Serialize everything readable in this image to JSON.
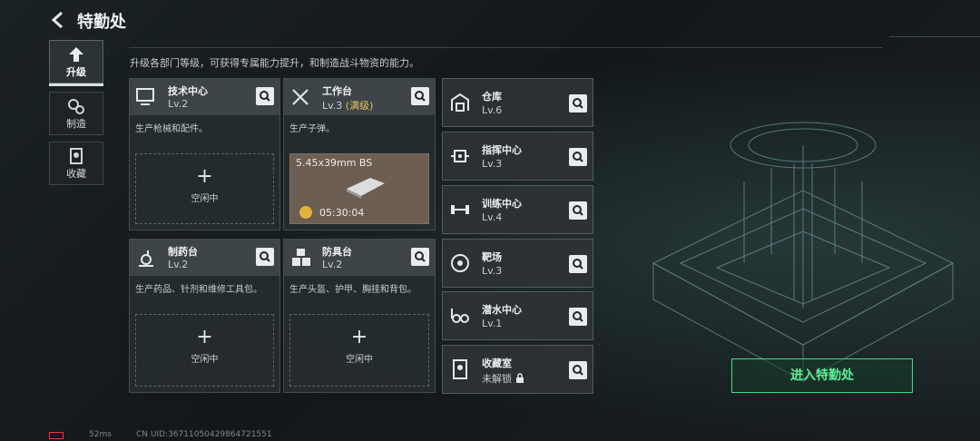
{
  "header": {
    "title": "特勤处",
    "back_icon": "back-arrow-icon"
  },
  "description": "升级各部门等级，可获得专属能力提升，和制造战斗物资的能力。",
  "nav": [
    {
      "label": "升级",
      "icon": "upgrade-icon",
      "active": true
    },
    {
      "label": "制造",
      "icon": "gears-icon",
      "active": false
    },
    {
      "label": "收藏",
      "icon": "collection-icon",
      "active": false
    }
  ],
  "cards": {
    "tech": {
      "name": "技术中心",
      "level": "Lv.2",
      "desc": "生产枪械和配件。",
      "slot": {
        "plus": "+",
        "label": "空闲中"
      }
    },
    "workbench": {
      "name": "工作台",
      "level": "Lv.3",
      "level_note": "(满级)",
      "desc": "生产子弹。",
      "production": {
        "item": "5.45x39mm BS",
        "time": "05:30:04"
      }
    },
    "pharmacy": {
      "name": "制药台",
      "level": "Lv.2",
      "desc": "生产药品、针剂和维修工具包。",
      "slot": {
        "plus": "+",
        "label": "空闲中"
      }
    },
    "armor": {
      "name": "防具台",
      "level": "Lv.2",
      "desc": "生产头盔、护甲、胸挂和背包。",
      "slot": {
        "plus": "+",
        "label": "空闲中"
      }
    }
  },
  "right_list": [
    {
      "name": "仓库",
      "level": "Lv.6",
      "icon": "warehouse-icon"
    },
    {
      "name": "指挥中心",
      "level": "Lv.3",
      "icon": "command-chip-icon"
    },
    {
      "name": "训练中心",
      "level": "Lv.4",
      "icon": "dumbbell-icon"
    },
    {
      "name": "靶场",
      "level": "Lv.3",
      "icon": "target-icon"
    },
    {
      "name": "潜水中心",
      "level": "Lv.1",
      "icon": "diving-mask-icon"
    },
    {
      "name": "收藏室",
      "level": "未解锁",
      "icon": "collection-room-icon",
      "locked": true
    }
  ],
  "enter_button": "进入特勤处",
  "footer": {
    "ping": "52ms",
    "uid": "CN UID:3671105042986472155​1"
  },
  "colors": {
    "accent_green": "#3ddc84",
    "max_level_gold": "#e6c25a"
  }
}
